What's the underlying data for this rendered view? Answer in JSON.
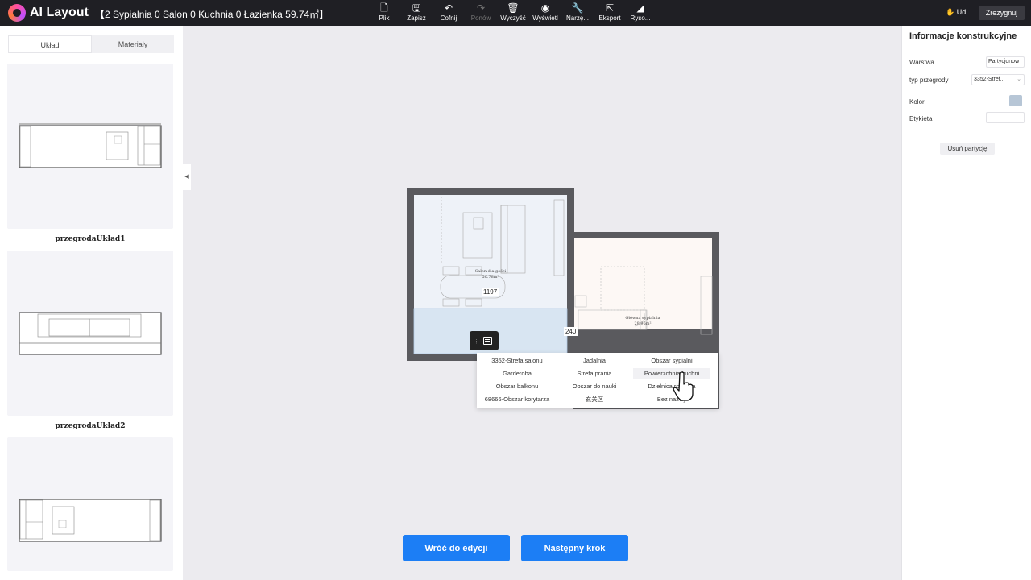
{
  "app": {
    "logo_text": "AI Layout",
    "project_title": "【2 Sypialnia 0 Salon 0 Kuchnia 0 Łazienka 59.74㎡】",
    "user_label": "Ud...",
    "save_label": "Zrezygnuj"
  },
  "toolbar": [
    {
      "label": "Plik",
      "icon": "file-icon",
      "disabled": false
    },
    {
      "label": "Zapisz",
      "icon": "save-icon",
      "disabled": false
    },
    {
      "label": "Cofnij",
      "icon": "undo-icon",
      "disabled": false
    },
    {
      "label": "Ponów",
      "icon": "redo-icon",
      "disabled": true
    },
    {
      "label": "Wyczyść",
      "icon": "trash-icon",
      "disabled": false
    },
    {
      "label": "Wyświetl",
      "icon": "eye-icon",
      "disabled": false
    },
    {
      "label": "Narzę...",
      "icon": "wrench-icon",
      "disabled": false
    },
    {
      "label": "Eksport",
      "icon": "export-icon",
      "disabled": false
    },
    {
      "label": "Ryso...",
      "icon": "pen-icon",
      "disabled": false
    }
  ],
  "left_panel": {
    "tabs": [
      {
        "label": "Układ",
        "active": true
      },
      {
        "label": "Materiały",
        "active": false
      }
    ],
    "layouts": [
      {
        "label": "przegrodaUkład1"
      },
      {
        "label": "przegrodaUkład2"
      },
      {
        "label": ""
      }
    ]
  },
  "right_panel": {
    "title": "Informacje konstrukcyjne",
    "layer_label": "Warstwa",
    "layer_value": "Partycjonow",
    "partition_type_label": "typ przegrody",
    "partition_type_value": "3352-Stref...",
    "color_label": "Kolor",
    "color_value": "#b7c6d6",
    "tag_label": "Etykieta",
    "tag_value": "",
    "delete_label": "Usuń partycję"
  },
  "floorplan": {
    "room1_name": "Salon dla gości",
    "room1_area": "50.78m²",
    "room2_name": "Główna sypialnia",
    "room2_area": "28.95m²",
    "dim_horizontal": "1197",
    "dim_vertical": "240"
  },
  "zone_menu": {
    "options": [
      "3352-Strefa salonu",
      "Jadalnia",
      "Obszar sypialni",
      "Garderoba",
      "Strefa prania",
      "Powierzchnia kuchni",
      "Obszar balkonu",
      "Obszar do nauki",
      "Dzielnica robocza",
      "68666-Obszar korytarza",
      "玄关区",
      "Bez nazwy"
    ],
    "hovered_index": 5
  },
  "bottom": {
    "back_label": "Wróć do edycji",
    "next_label": "Następny krok"
  }
}
